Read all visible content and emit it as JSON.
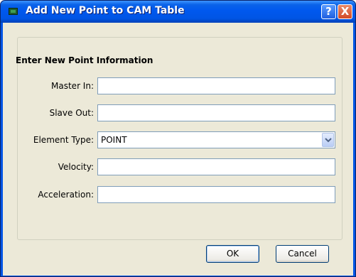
{
  "window": {
    "title": "Add New Point to CAM Table",
    "help_glyph": "?",
    "close_glyph": "X"
  },
  "form": {
    "section_title": "Enter New Point Information",
    "fields": {
      "master_in": {
        "label": "Master In:",
        "value": ""
      },
      "slave_out": {
        "label": "Slave Out:",
        "value": ""
      },
      "element_type": {
        "label": "Element Type:",
        "value": "POINT"
      },
      "velocity": {
        "label": "Velocity:",
        "value": ""
      },
      "acceleration": {
        "label": "Acceleration:",
        "value": ""
      }
    }
  },
  "buttons": {
    "ok": "OK",
    "cancel": "Cancel"
  },
  "colors": {
    "titlebar": "#0055e5",
    "client_bg": "#ece9d8",
    "field_border": "#7f9db9"
  },
  "icons": {
    "app": "window-app-icon",
    "help": "help-icon",
    "close": "close-icon",
    "dropdown": "chevron-down-icon"
  }
}
